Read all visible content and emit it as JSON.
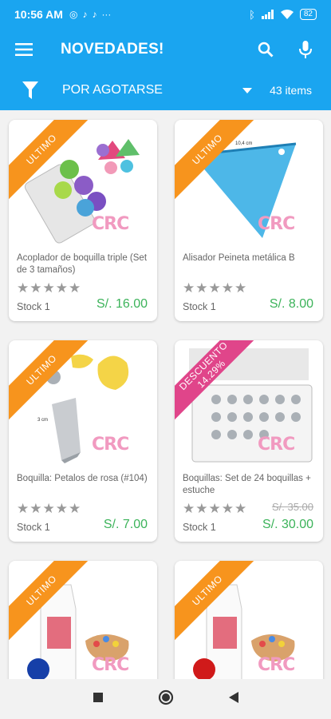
{
  "status": {
    "time": "10:56 AM",
    "battery": "82"
  },
  "app_bar": {
    "title": "NOVEDADES!"
  },
  "filter_bar": {
    "sort_label": "POR AGOTARSE",
    "item_count": "43 items"
  },
  "products": [
    {
      "name": "Acoplador de boquilla triple (Set de 3 tamaños)",
      "ribbon": "ULTIMO",
      "ribbon_color": "#f7941d",
      "stars": "★★★★★",
      "stock": "Stock 1",
      "price": "S/. 16.00",
      "old_price": ""
    },
    {
      "name": "Alisador Peineta metálica B",
      "ribbon": "ULTIMO",
      "ribbon_color": "#f7941d",
      "stars": "★★★★★",
      "stock": "Stock 1",
      "price": "S/. 8.00",
      "old_price": ""
    },
    {
      "name": "Boquilla: Petalos de rosa (#104)",
      "ribbon": "ULTIMO",
      "ribbon_color": "#f7941d",
      "stars": "★★★★★",
      "stock": "Stock 1",
      "price": "S/. 7.00",
      "old_price": ""
    },
    {
      "name": "Boquillas: Set de 24 boquillas + estuche",
      "ribbon": "DESCUENTO\n14.29%",
      "ribbon_color": "#e0458a",
      "stars": "★★★★★",
      "stock": "Stock 1",
      "price": "S/. 30.00",
      "old_price": "S/. 35.00"
    },
    {
      "name": "",
      "ribbon": "ULTIMO",
      "ribbon_color": "#f7941d",
      "stars": "",
      "stock": "",
      "price": "",
      "old_price": ""
    },
    {
      "name": "",
      "ribbon": "ULTIMO",
      "ribbon_color": "#f7941d",
      "stars": "",
      "stock": "",
      "price": "",
      "old_price": ""
    }
  ],
  "images": {
    "brand_logo": "CRC",
    "ruler_label": "10,4 cm",
    "tip_size_label": "3 cm"
  },
  "colors": {
    "primary": "#1aa5f0",
    "price": "#3cb35a",
    "ribbon_orange": "#f7941d",
    "ribbon_pink": "#e0458a"
  }
}
